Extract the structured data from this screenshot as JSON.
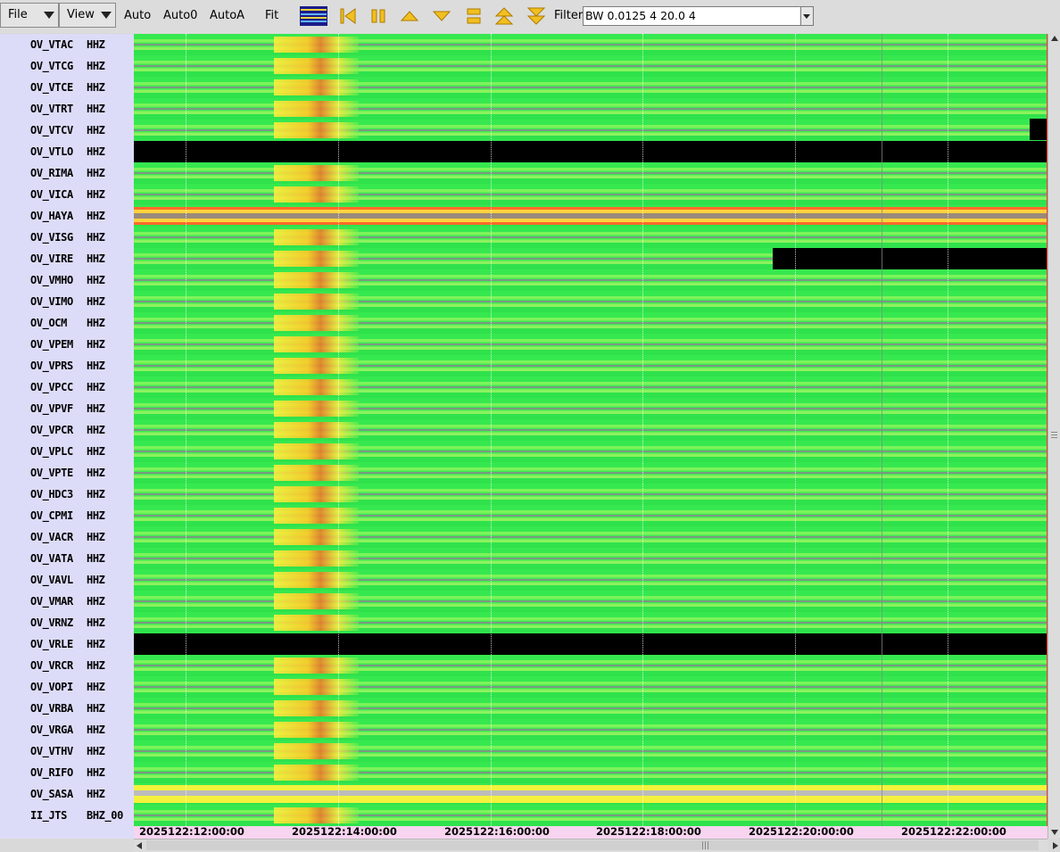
{
  "toolbar": {
    "file_label": "File",
    "view_label": "View",
    "auto_label": "Auto",
    "auto0_label": "Auto0",
    "autoa_label": "AutoA",
    "fit_label": "Fit",
    "filter_label": "Filter",
    "filter_value": "BW 0.0125 4 20.0 4",
    "icons": [
      "spectrogram-icon",
      "go-start-icon",
      "pause-icon",
      "scroll-up-icon",
      "scroll-down-icon",
      "compress-icon",
      "page-up-icon",
      "page-down-icon"
    ]
  },
  "colors": {
    "label_bg": "#dcdcf8",
    "plot_green": "#3fe853",
    "time_axis_bg": "#f7d4ef",
    "gap_black": "#000000",
    "trace_gray": "#8a8a8a"
  },
  "stations": [
    {
      "name": "OV_VTAC",
      "channel": "HHZ"
    },
    {
      "name": "OV_VTCG",
      "channel": "HHZ"
    },
    {
      "name": "OV_VTCE",
      "channel": "HHZ"
    },
    {
      "name": "OV_VTRT",
      "channel": "HHZ"
    },
    {
      "name": "OV_VTCV",
      "channel": "HHZ"
    },
    {
      "name": "OV_VTLO",
      "channel": "HHZ"
    },
    {
      "name": "OV_RIMA",
      "channel": "HHZ"
    },
    {
      "name": "OV_VICA",
      "channel": "HHZ"
    },
    {
      "name": "OV_HAYA",
      "channel": "HHZ"
    },
    {
      "name": "OV_VISG",
      "channel": "HHZ"
    },
    {
      "name": "OV_VIRE",
      "channel": "HHZ"
    },
    {
      "name": "OV_VMHO",
      "channel": "HHZ"
    },
    {
      "name": "OV_VIMO",
      "channel": "HHZ"
    },
    {
      "name": "OV_OCM",
      "channel": "HHZ"
    },
    {
      "name": "OV_VPEM",
      "channel": "HHZ"
    },
    {
      "name": "OV_VPRS",
      "channel": "HHZ"
    },
    {
      "name": "OV_VPCC",
      "channel": "HHZ"
    },
    {
      "name": "OV_VPVF",
      "channel": "HHZ"
    },
    {
      "name": "OV_VPCR",
      "channel": "HHZ"
    },
    {
      "name": "OV_VPLC",
      "channel": "HHZ"
    },
    {
      "name": "OV_VPTE",
      "channel": "HHZ"
    },
    {
      "name": "OV_HDC3",
      "channel": "HHZ"
    },
    {
      "name": "OV_CPMI",
      "channel": "HHZ"
    },
    {
      "name": "OV_VACR",
      "channel": "HHZ"
    },
    {
      "name": "OV_VATA",
      "channel": "HHZ"
    },
    {
      "name": "OV_VAVL",
      "channel": "HHZ"
    },
    {
      "name": "OV_VMAR",
      "channel": "HHZ"
    },
    {
      "name": "OV_VRNZ",
      "channel": "HHZ"
    },
    {
      "name": "OV_VRLE",
      "channel": "HHZ"
    },
    {
      "name": "OV_VRCR",
      "channel": "HHZ"
    },
    {
      "name": "OV_VOPI",
      "channel": "HHZ"
    },
    {
      "name": "OV_VRBA",
      "channel": "HHZ"
    },
    {
      "name": "OV_VRGA",
      "channel": "HHZ"
    },
    {
      "name": "OV_VTHV",
      "channel": "HHZ"
    },
    {
      "name": "OV_RIFO",
      "channel": "HHZ"
    },
    {
      "name": "OV_SASA",
      "channel": "HHZ"
    },
    {
      "name": "II_JTS",
      "channel": "BHZ_00"
    }
  ],
  "time_axis": {
    "labels": [
      "2025122:12:00:00",
      "2025122:14:00:00",
      "2025122:16:00:00",
      "2025122:18:00:00",
      "2025122:20:00:00",
      "2025122:22:00:00"
    ]
  }
}
